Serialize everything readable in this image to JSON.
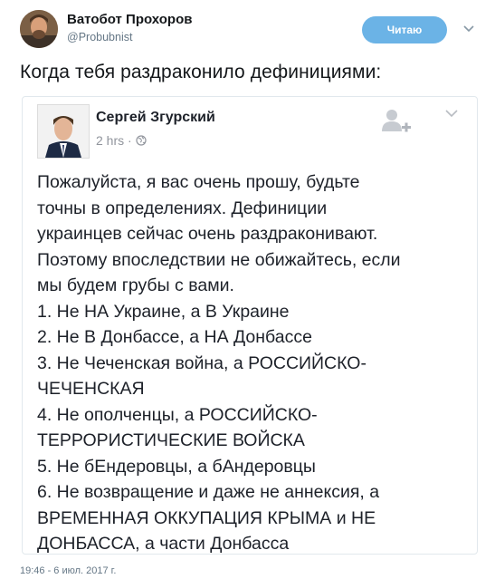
{
  "tweet": {
    "author_name": "Ватобот Прохоров",
    "author_handle": "@Probubnist",
    "follow_label": "Читаю",
    "text": "Когда тебя раздраконило дефинициями:",
    "timestamp": "19:46 - 6 июл. 2017 г."
  },
  "quoted_post": {
    "author_name": "Сергей Згурский",
    "time": "2 hrs ·",
    "lines": [
      "Пожалуйста, я вас очень прошу, будьте",
      "точны в определениях. Дефиниции",
      "украинцев сейчас очень раздраконивают.",
      "Поэтому впоследствии не обижайтесь, если",
      "мы будем грубы с вами.",
      "1. Не НА Украине, а В Украине",
      "2. Не В Донбассе, а НА Донбассе",
      "3. Не Чеченская война, а РОССИЙСКО-",
      "ЧЕЧЕНСКАЯ",
      "4. Не ополченцы, а РОССИЙСКО-",
      "ТЕРРОРИСТИЧЕСКИЕ ВОЙСКА",
      "5. Не бЕндеровцы, а бАндеровцы",
      "6. Не возвращение и даже не аннексия, а",
      "ВРЕМЕННАЯ ОККУПАЦИЯ КРЫМА и НЕ",
      "ДОНБАССА, а части Донбасса"
    ]
  },
  "icons": {
    "more": "chevron-down-icon",
    "globe": "globe-icon",
    "add_friend": "add-friend-icon"
  },
  "colors": {
    "follow_button": "#6bb3e6",
    "handle": "#657786",
    "fb_meta": "#90949c"
  }
}
